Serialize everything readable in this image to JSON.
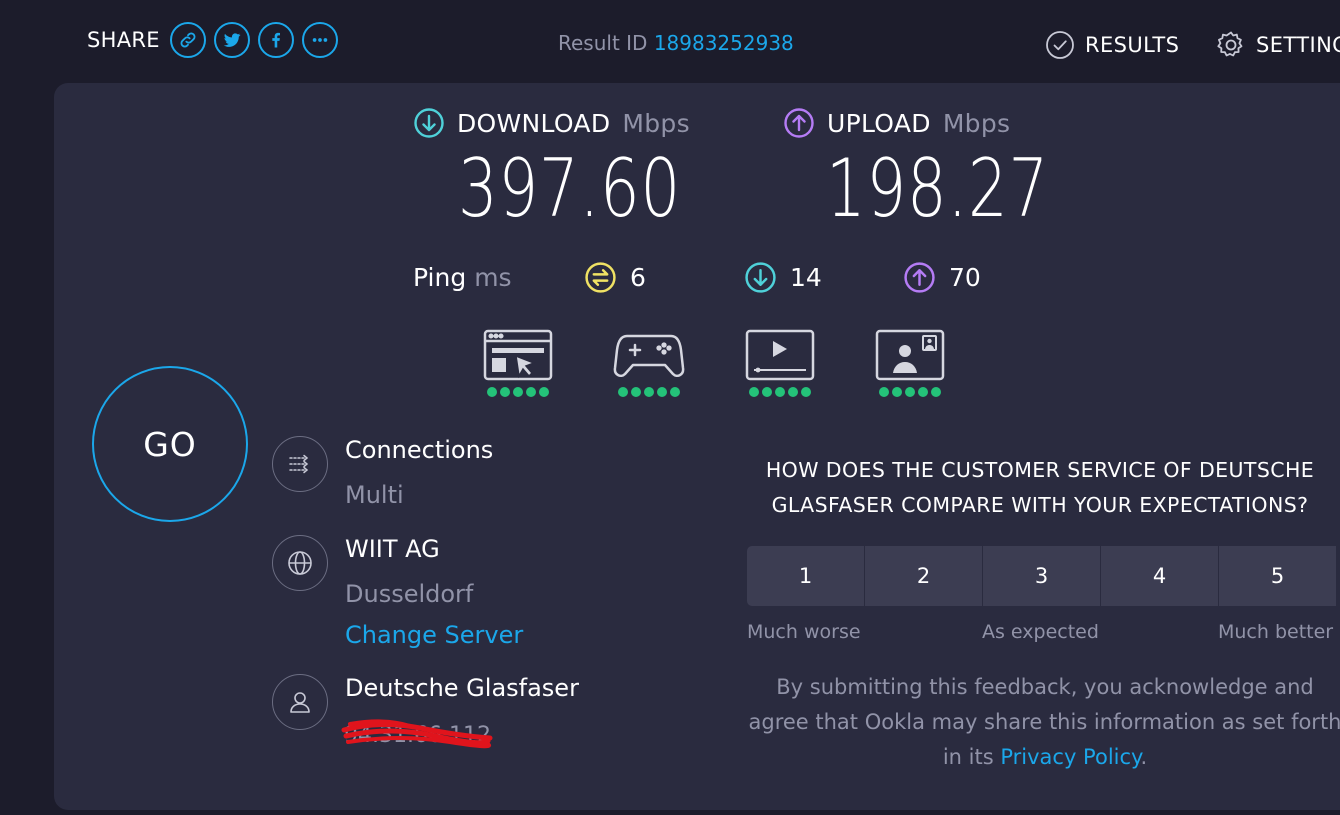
{
  "header": {
    "share_label": "SHARE",
    "share_buttons": [
      {
        "name": "link-icon"
      },
      {
        "name": "twitter-icon"
      },
      {
        "name": "facebook-icon"
      },
      {
        "name": "more-icon"
      }
    ],
    "result_id_label": "Result ID",
    "result_id_value": "18983252938",
    "results_label": "RESULTS",
    "settings_label": "SETTINGS"
  },
  "speeds": {
    "download": {
      "label": "DOWNLOAD",
      "unit": "Mbps",
      "value": "397.60",
      "color": "#4fd1d9"
    },
    "upload": {
      "label": "UPLOAD",
      "unit": "Mbps",
      "value": "198.27",
      "color": "#b57cf5"
    }
  },
  "ping": {
    "label": "Ping",
    "unit": "ms",
    "idle": {
      "value": "6",
      "color": "#f0e264"
    },
    "download": {
      "value": "14",
      "color": "#4fd1d9"
    },
    "upload": {
      "value": "70",
      "color": "#b57cf5"
    }
  },
  "quality": [
    {
      "icon": "web-browsing-icon",
      "rating": 5
    },
    {
      "icon": "gaming-icon",
      "rating": 5
    },
    {
      "icon": "video-streaming-icon",
      "rating": 5
    },
    {
      "icon": "video-chat-icon",
      "rating": 5
    }
  ],
  "go_label": "GO",
  "connections": {
    "title": "Connections",
    "value": "Multi"
  },
  "server": {
    "name": "WIIT AG",
    "location": "Dusseldorf",
    "change_label": "Change Server"
  },
  "provider": {
    "name": "Deutsche Glasfaser",
    "ip_redacted": "94.31.66.112"
  },
  "survey": {
    "question": "HOW DOES THE CUSTOMER SERVICE OF DEUTSCHE\nGLASFASER COMPARE WITH YOUR EXPECTATIONS?",
    "options": [
      "1",
      "2",
      "3",
      "4",
      "5"
    ],
    "label_low": "Much worse",
    "label_mid": "As expected",
    "label_high": "Much better",
    "disclaimer_before": "By submitting this feedback, you acknowledge and agree that Ookla may share this information as set forth in its ",
    "privacy_label": "Privacy Policy",
    "disclaimer_after": "."
  },
  "colors": {
    "accent": "#1ba7ea",
    "good": "#24c279",
    "background": "#1c1c2b",
    "card": "#2a2b3f"
  }
}
